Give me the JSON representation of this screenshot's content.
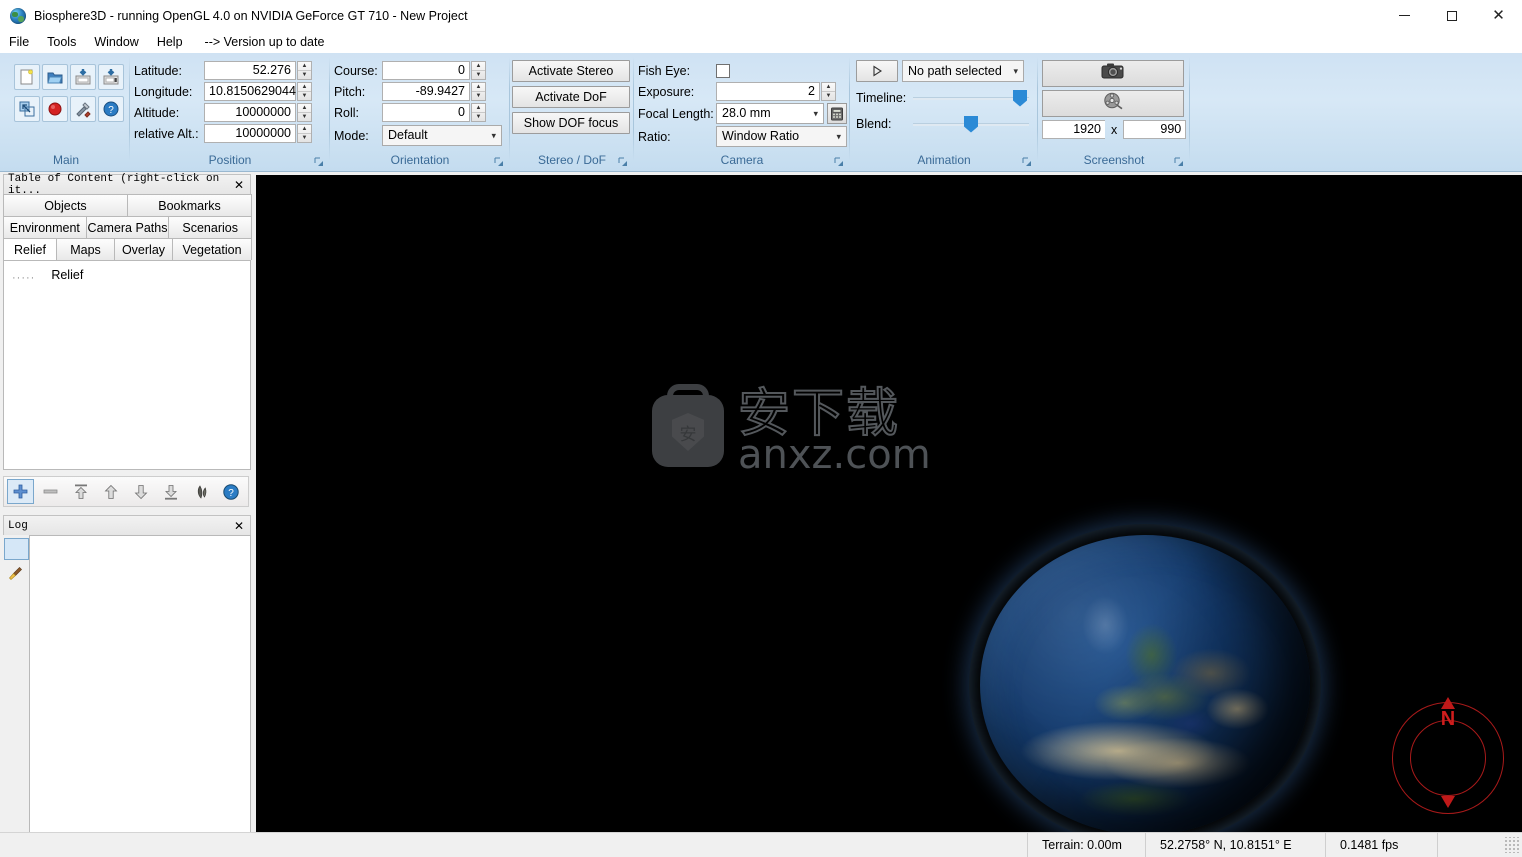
{
  "window": {
    "title": "Biosphere3D - running OpenGL 4.0 on NVIDIA GeForce GT 710 - New Project",
    "app_icon": "globe-icon",
    "minimize": "–",
    "maximize": "□",
    "close": "✕"
  },
  "menu": {
    "items": [
      "File",
      "Tools",
      "Window",
      "Help"
    ],
    "version_note": "--> Version up to date"
  },
  "ribbon": {
    "groups": [
      {
        "label": "Main",
        "has_launcher": false
      },
      {
        "label": "Position",
        "has_launcher": true
      },
      {
        "label": "Orientation",
        "has_launcher": true
      },
      {
        "label": "Stereo / DoF",
        "has_launcher": true
      },
      {
        "label": "Camera",
        "has_launcher": true
      },
      {
        "label": "Animation",
        "has_launcher": true
      },
      {
        "label": "Screenshot",
        "has_launcher": true
      }
    ],
    "main": {
      "buttons": [
        {
          "name": "new-project-icon",
          "title": "New"
        },
        {
          "name": "open-project-icon",
          "title": "Open"
        },
        {
          "name": "save-project-icon",
          "title": "Save"
        },
        {
          "name": "save-as-project-icon",
          "title": "Save As"
        },
        {
          "name": "fit-window-icon",
          "title": "Resize"
        },
        {
          "name": "record-icon",
          "title": "Record"
        },
        {
          "name": "tools-icon",
          "title": "Tools"
        },
        {
          "name": "help-icon",
          "title": "Help"
        }
      ]
    },
    "position": {
      "latitude_label": "Latitude:",
      "latitude_value": "52.276",
      "longitude_label": "Longitude:",
      "longitude_value": "10.8150629044",
      "altitude_label": "Altitude:",
      "altitude_value": "10000000",
      "relative_alt_label": "relative Alt.:",
      "relative_alt_value": "10000000"
    },
    "orientation": {
      "course_label": "Course:",
      "course_value": "0",
      "pitch_label": "Pitch:",
      "pitch_value": "-89.9427",
      "roll_label": "Roll:",
      "roll_value": "0",
      "mode_label": "Mode:",
      "mode_value": "Default"
    },
    "stereo": {
      "activate_stereo": "Activate Stereo",
      "activate_dof": "Activate DoF",
      "show_dof_focus": "Show DOF focus"
    },
    "camera": {
      "fish_eye_label": "Fish Eye:",
      "fish_eye_checked": false,
      "exposure_label": "Exposure:",
      "exposure_value": "2",
      "focal_length_label": "Focal Length:",
      "focal_length_value": "28.0 mm",
      "focal_calc_icon": "calculator-icon",
      "ratio_label": "Ratio:",
      "ratio_value": "Window Ratio"
    },
    "animation": {
      "play_icon": "play-icon",
      "path_value": "No path selected",
      "timeline_label": "Timeline:",
      "timeline_percent": 100,
      "blend_label": "Blend:",
      "blend_percent": 45
    },
    "screenshot": {
      "camera_icon": "camera-icon",
      "movie_icon": "film-reel-icon",
      "width_value": "1920",
      "separator": "x",
      "height_value": "990"
    }
  },
  "dock": {
    "toc": {
      "title": "Table of Content (right-click on it...",
      "close": "✕",
      "tabs_row1": [
        "Objects",
        "Bookmarks"
      ],
      "tabs_row2": [
        "Environment",
        "Camera Paths",
        "Scenarios"
      ],
      "tabs_row3": [
        "Relief",
        "Maps",
        "Overlay",
        "Vegetation"
      ],
      "active_tab": "Relief",
      "tree_items": [
        {
          "dots": "·····",
          "label": "Relief"
        }
      ],
      "toolbar": [
        {
          "name": "add-icon",
          "glyph": "+"
        },
        {
          "name": "remove-icon",
          "glyph": "–"
        },
        {
          "name": "move-to-top-icon",
          "glyph": "top"
        },
        {
          "name": "move-up-icon",
          "glyph": "up"
        },
        {
          "name": "move-down-icon",
          "glyph": "down"
        },
        {
          "name": "move-to-bottom-icon",
          "glyph": "bottom"
        },
        {
          "name": "vegetation-leaf-icon",
          "glyph": "leaf"
        },
        {
          "name": "help-icon",
          "glyph": "?"
        }
      ]
    },
    "log": {
      "title": "Log",
      "close": "✕",
      "buttons": [
        {
          "name": "stop-log-icon"
        },
        {
          "name": "clear-log-broom-icon"
        }
      ],
      "content": ""
    }
  },
  "viewport": {
    "watermark": {
      "cn_text": "安下载",
      "en_text": "anxz.com",
      "bag_mark": "安"
    },
    "compass": {
      "north_label": "N",
      "color": "#c01919"
    }
  },
  "statusbar": {
    "terrain": "Terrain: 0.00m",
    "coordinates": "52.2758° N, 10.8151° E",
    "fps": "0.1481 fps"
  },
  "colors": {
    "ribbon_top": "#cfe2f3",
    "group_label": "#3a6a96",
    "accent_slider": "#2b8ad6",
    "compass_red": "#c01919",
    "viewport_bg": "#000000"
  }
}
